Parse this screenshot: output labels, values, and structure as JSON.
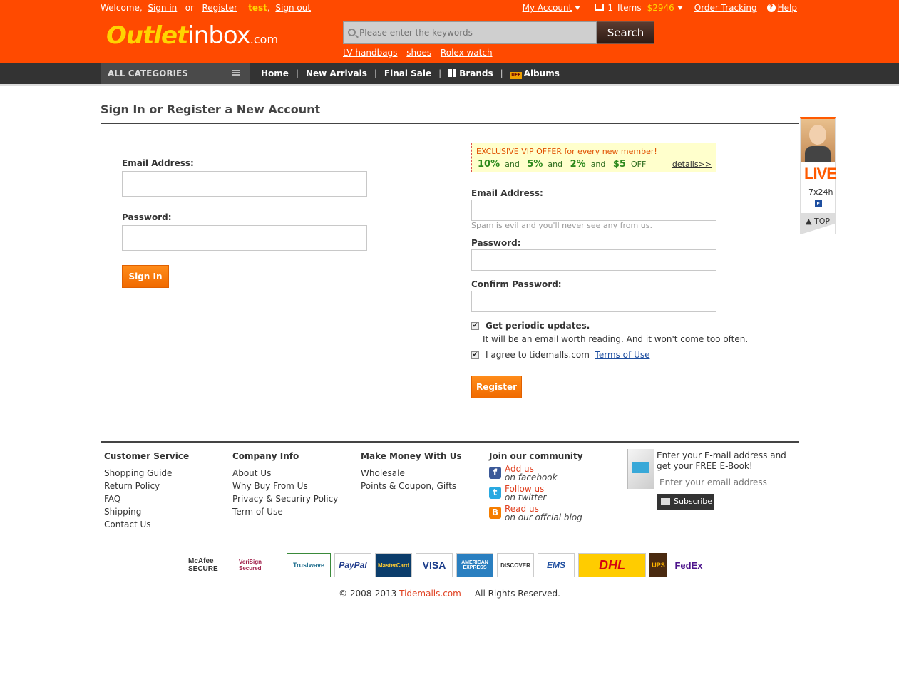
{
  "topbar": {
    "welcome": "Welcome,",
    "sign_in": "Sign in",
    "or": "or",
    "register": "Register",
    "username": "test",
    "comma": ",",
    "sign_out": "Sign out",
    "my_account": "My Account",
    "cart_count": "1",
    "items": "Items",
    "cart_total": "$2946",
    "order_tracking": "Order Tracking",
    "help": "Help"
  },
  "logo": {
    "part1": "Outlet",
    "part2": "inbox",
    "part3": ".com"
  },
  "search": {
    "placeholder": "Please enter the keywords",
    "button": "Search",
    "hot": [
      "LV handbags",
      "shoes",
      "Rolex watch"
    ]
  },
  "nav": {
    "all_categories": "ALL CATEGORIES",
    "links": [
      "Home",
      "New Arrivals",
      "Final Sale",
      "Brands",
      "Albums"
    ],
    "sep": "|"
  },
  "page": {
    "title": "Sign In or Register a New Account"
  },
  "signin": {
    "email_label": "Email Address:",
    "password_label": "Password:",
    "button": "Sign In"
  },
  "vip": {
    "title": "EXCLUSIVE VIP OFFER for every new member!",
    "p1": "10%",
    "p2": "5%",
    "p3": "2%",
    "p4": "$5",
    "and": "and",
    "off": "OFF",
    "details": "details>>"
  },
  "register": {
    "email_label": "Email Address:",
    "spam_hint": "Spam is evil and you'll never see any from us.",
    "password_label": "Password:",
    "confirm_label": "Confirm Password:",
    "updates_label": "Get periodic updates.",
    "updates_hint": "It will be an email worth reading. And it won't come too often.",
    "agree_text": "I agree to tidemalls.com",
    "terms_link": "Terms of Use",
    "button": "Register"
  },
  "live": {
    "title": "LIVE",
    "hours": "7x24h",
    "top": "TOP"
  },
  "footer": {
    "col1": {
      "title": "Customer Service",
      "items": [
        "Shopping Guide",
        "Return Policy",
        "FAQ",
        "Shipping",
        "Contact Us"
      ]
    },
    "col2": {
      "title": "Company Info",
      "items": [
        "About Us",
        "Why Buy From Us",
        "Privacy & Securiry Policy",
        "Term of Use"
      ]
    },
    "col3": {
      "title": "Make Money With Us",
      "items": [
        "Wholesale",
        "Points & Coupon, Gifts"
      ]
    },
    "community": {
      "title": "Join our community",
      "items": [
        {
          "a": "Add us",
          "b": "on facebook"
        },
        {
          "a": "Follow us",
          "b": "on twitter"
        },
        {
          "a": "Read us",
          "b": "on our offcial blog"
        }
      ]
    },
    "ebook": {
      "text": "Enter your E-mail address and get your FREE E-Book!",
      "placeholder": "Enter your email address",
      "button": "Subscribe"
    },
    "badges": [
      "McAfee SECURE",
      "VeriSign Secured",
      "Trustwave",
      "PayPal",
      "MasterCard",
      "VISA",
      "AMERICAN EXPRESS",
      "DISCOVER",
      "EMS",
      "DHL",
      "UPS",
      "FedEx"
    ],
    "copyright_pre": "© 2008-2013",
    "copyright_brand": "Tidemalls.com",
    "copyright_post": "All Rights Reserved."
  }
}
